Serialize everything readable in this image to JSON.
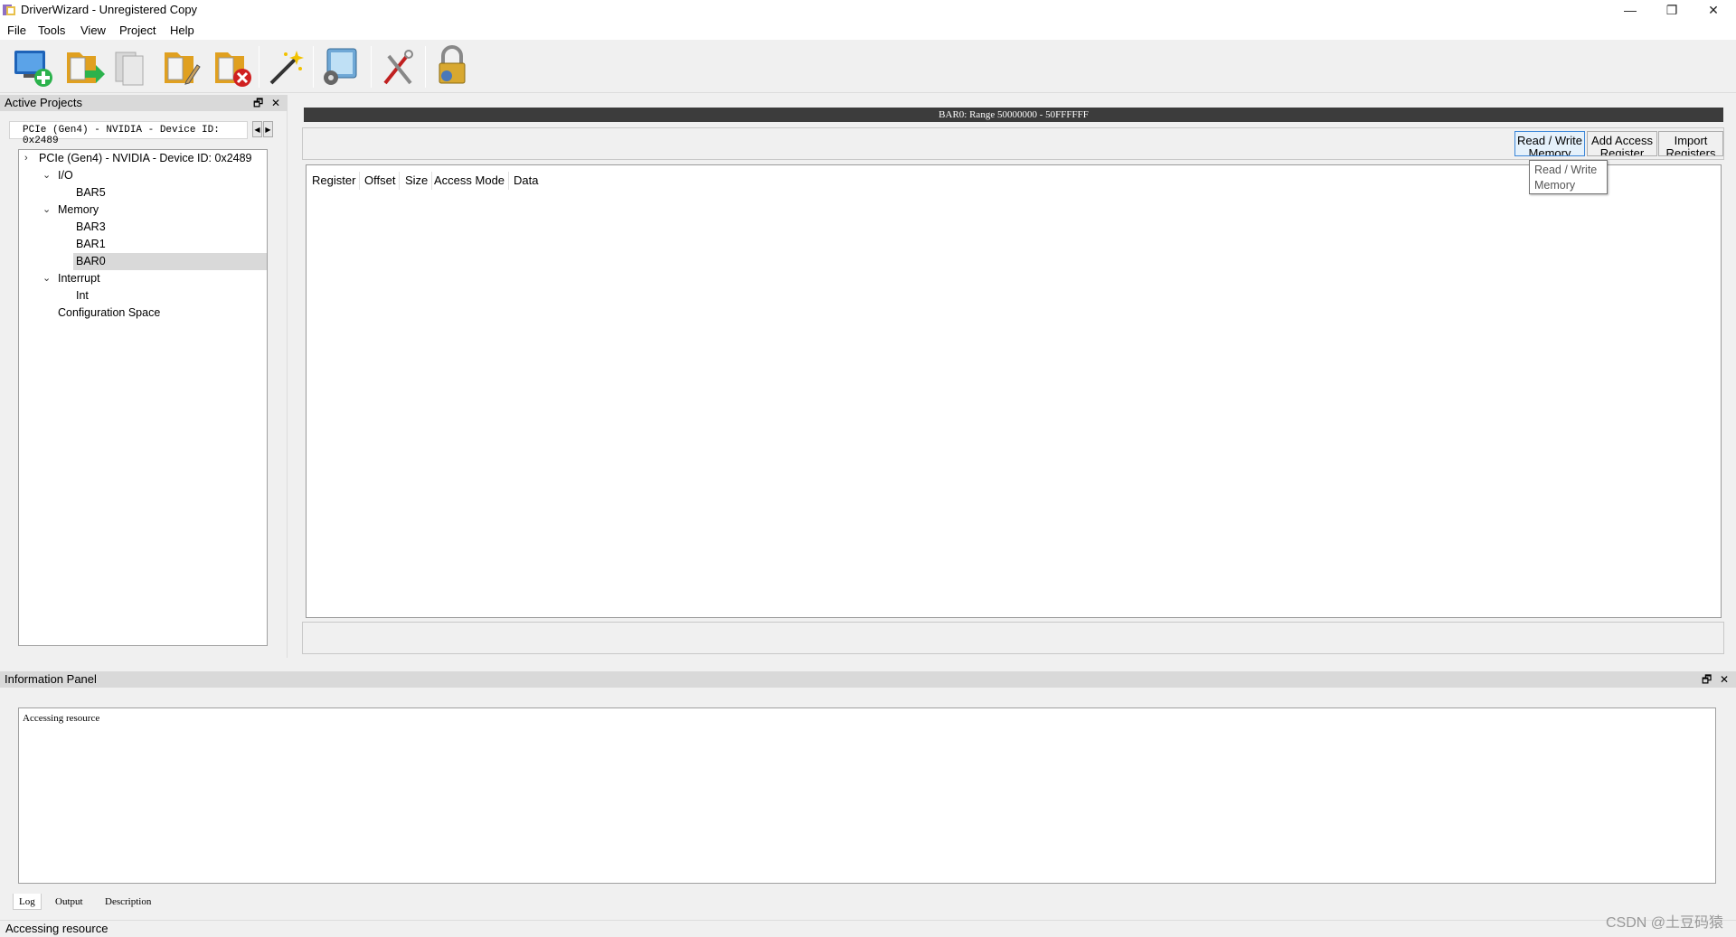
{
  "window": {
    "title": "DriverWizard - Unregistered Copy",
    "minimize": "—",
    "restore": "❐",
    "close": "✕"
  },
  "menu": {
    "file": "File",
    "tools": "Tools",
    "view": "View",
    "project": "Project",
    "help": "Help"
  },
  "toolbar": {
    "icons": [
      "new-project-icon",
      "open-project-icon",
      "save-project-icon",
      "edit-project-icon",
      "close-project-icon",
      "wizard-wand-icon",
      "device-config-icon",
      "tools-icon",
      "lock-icon"
    ]
  },
  "left_panel": {
    "header": "Active Projects",
    "project_tab": "PCIe (Gen4) - NVIDIA - Device ID: 0x2489",
    "tree": {
      "root": "PCIe (Gen4) - NVIDIA - Device ID: 0x2489",
      "io": "I/O",
      "bar5": "BAR5",
      "memory": "Memory",
      "bar3": "BAR3",
      "bar1": "BAR1",
      "bar0": "BAR0",
      "interrupt": "Interrupt",
      "int": "Int",
      "config_space": "Configuration Space"
    }
  },
  "main": {
    "bar_header": "BAR0: Range 50000000 - 50FFFFFF",
    "buttons": {
      "read_write": "Read / Write Memory",
      "add_access": "Add Access Register",
      "import": "Import Registers"
    },
    "columns": [
      "Register",
      "Offset",
      "Size",
      "Access Mode",
      "Data"
    ],
    "tooltip_line1": "Read / Write",
    "tooltip_line2": "Memory"
  },
  "info_panel": {
    "header": "Information Panel",
    "log_text": "Accessing resource",
    "tabs": [
      "Log",
      "Output",
      "Description"
    ]
  },
  "status": {
    "text": "Accessing resource"
  },
  "watermark": "CSDN @土豆码猿",
  "colors": {
    "header_bar": "#3c3c3c",
    "selection": "#d9d9d9",
    "active_button_border": "#3b86d8"
  }
}
